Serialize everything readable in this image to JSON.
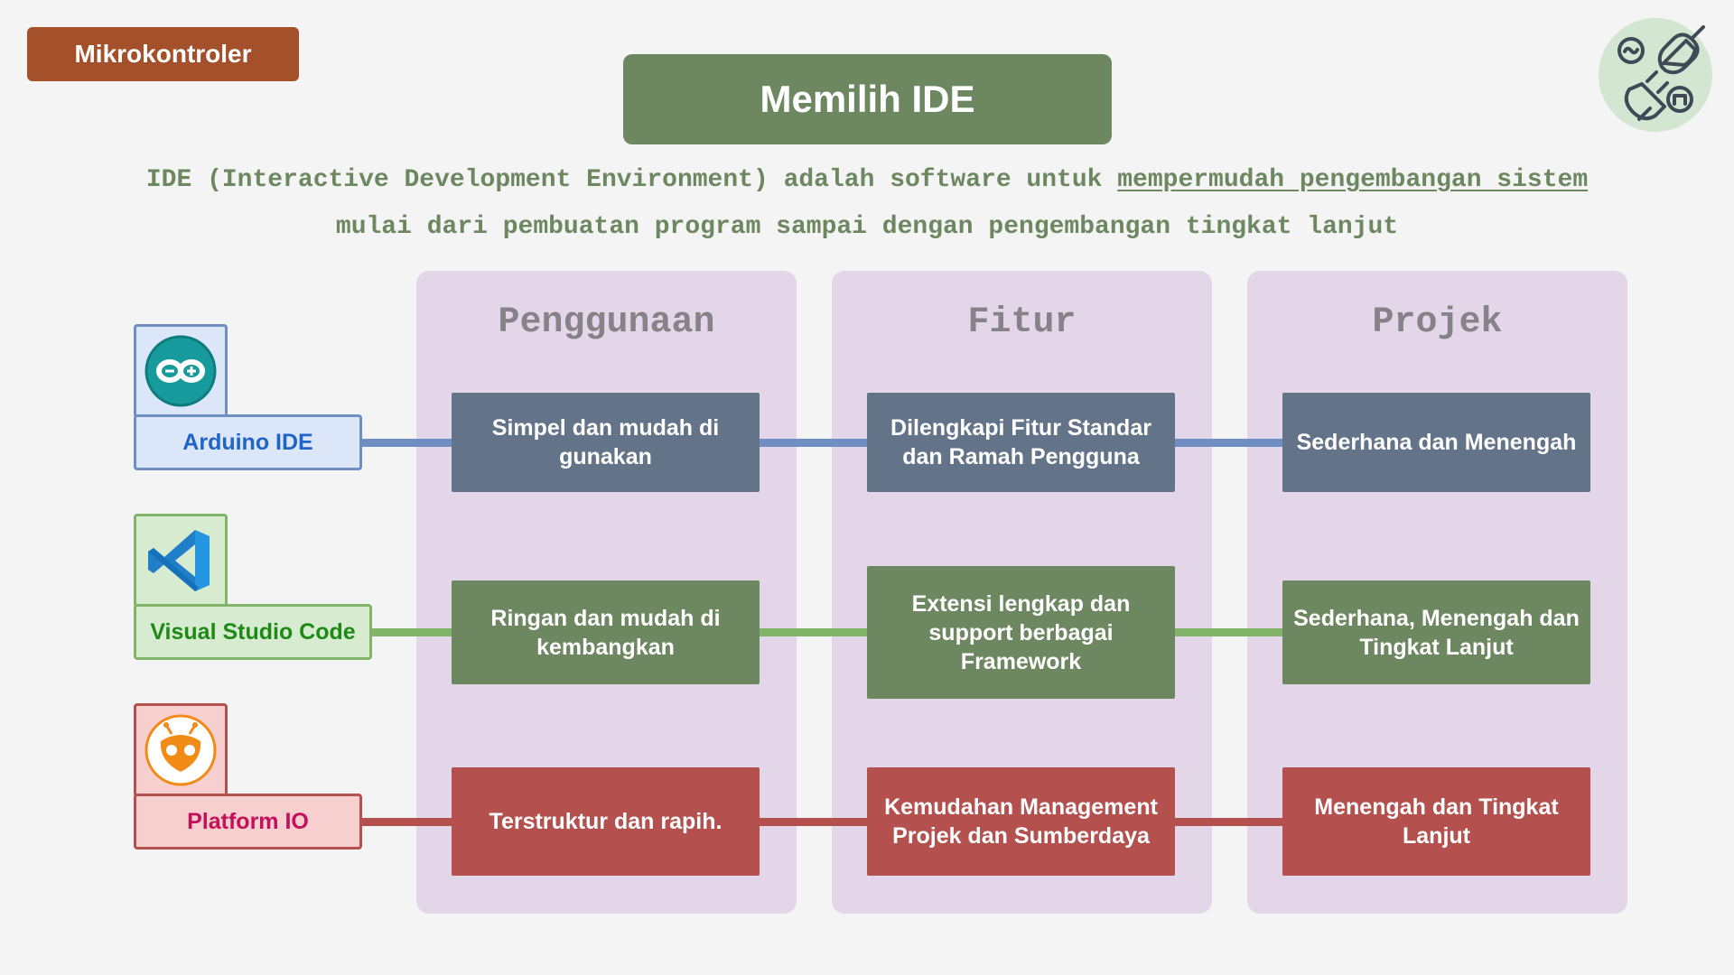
{
  "header": {
    "tag_label": "Mikrokontroler",
    "title": "Memilih IDE",
    "logo_icon": "plug-circuit-icon"
  },
  "description": {
    "line1_pre": "IDE (Interactive Development Environment) adalah software untuk ",
    "line1_link": "mempermudah pengembangan sistem",
    "line2": "mulai dari pembuatan program sampai dengan pengembangan tingkat lanjut"
  },
  "columns": [
    "Penggunaan",
    "Fitur",
    "Projek"
  ],
  "ides": [
    {
      "name": "Arduino IDE",
      "icon": "arduino-icon",
      "color": "#6f8fc3",
      "usage": "Simpel dan mudah di gunakan",
      "feature": "Dilengkapi Fitur Standar dan Ramah Pengguna",
      "project": "Sederhana dan Menengah"
    },
    {
      "name": "Visual Studio Code",
      "icon": "vscode-icon",
      "color": "#82b56a",
      "usage": "Ringan dan mudah di kembangkan",
      "feature": "Extensi lengkap dan support berbagai Framework",
      "project": "Sederhana, Menengah dan Tingkat Lanjut"
    },
    {
      "name": "Platform IO",
      "icon": "platformio-icon",
      "color": "#b4504e",
      "usage": "Terstruktur dan rapih.",
      "feature": "Kemudahan Management Projek dan Sumberdaya",
      "project": "Menengah dan Tingkat Lanjut"
    }
  ]
}
